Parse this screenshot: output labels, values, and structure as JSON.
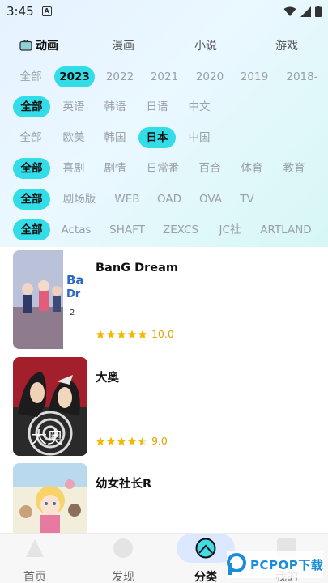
{
  "status": {
    "time": "3:45",
    "notification_icon": "a-notification-icon"
  },
  "tabs": [
    {
      "label": "动画",
      "active": true,
      "icon": "tv-icon"
    },
    {
      "label": "漫画",
      "active": false
    },
    {
      "label": "小说",
      "active": false
    },
    {
      "label": "游戏",
      "active": false
    }
  ],
  "filters": {
    "years": [
      "全部",
      "2023",
      "2022",
      "2021",
      "2020",
      "2019",
      "2018-"
    ],
    "languages": [
      "全部",
      "英语",
      "韩语",
      "日语",
      "中文"
    ],
    "regions": [
      "全部",
      "欧美",
      "韩国",
      "日本",
      "中国"
    ],
    "genres": [
      "全部",
      "喜剧",
      "剧情",
      "日常番",
      "百合",
      "体育",
      "教育"
    ],
    "formats": [
      "全部",
      "剧场版",
      "WEB",
      "OAD",
      "OVA",
      "TV"
    ],
    "studios": [
      "全部",
      "Actas",
      "SHAFT",
      "ZEXCS",
      "JC社",
      "ARTLAND"
    ]
  },
  "list": [
    {
      "title": "BanG Dream",
      "score": "10.0",
      "stars": 5
    },
    {
      "title": "大奥",
      "score": "9.0",
      "stars": 4.5
    },
    {
      "title": "幼女社长R",
      "score": "",
      "stars": 0
    }
  ],
  "bottom_nav": [
    {
      "label": "首页",
      "icon": "home-icon"
    },
    {
      "label": "发现",
      "icon": "discover-icon"
    },
    {
      "label": "分类",
      "icon": "category-icon",
      "active": true
    },
    {
      "label": "我的",
      "icon": "profile-icon"
    }
  ],
  "watermark": {
    "text": "PCPOP下载"
  },
  "colors": {
    "accent": "#33dde8",
    "star": "#f5b800",
    "nav_active_bg": "#dce8ff"
  }
}
